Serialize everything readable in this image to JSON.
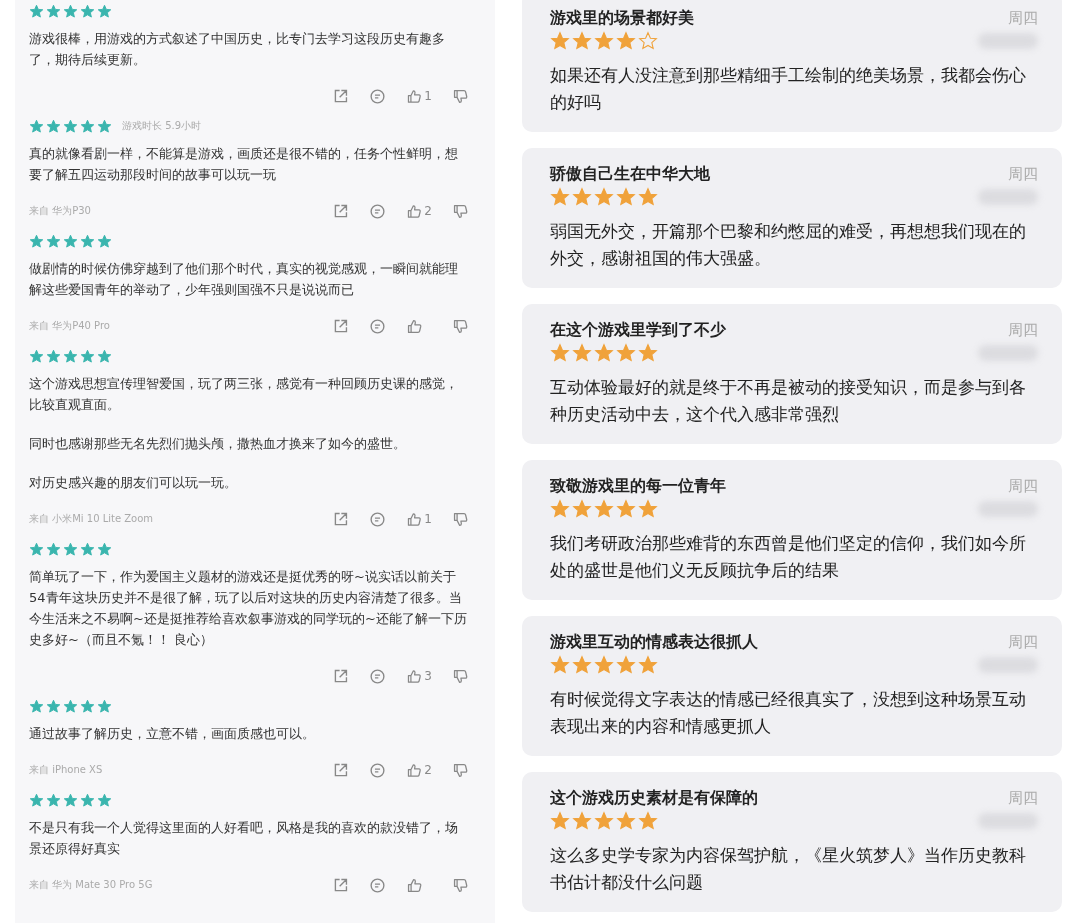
{
  "app_reviews": [
    {
      "stars": 5,
      "paragraphs": [
        "游戏很棒，用游戏的方式叙述了中国历史，比专门去学习这段历史有趣多了，期待后续更新。"
      ],
      "likes": "1"
    },
    {
      "stars": 5,
      "playtime": "游戏时长 5.9小时",
      "paragraphs": [
        "真的就像看剧一样，不能算是游戏，画质还是很不错的，任务个性鲜明，想要了解五四运动那段时间的故事可以玩一玩"
      ],
      "device": "来自 华为P30",
      "likes": "2"
    },
    {
      "stars": 5,
      "paragraphs": [
        "做剧情的时候仿佛穿越到了他们那个时代，真实的视觉感观，一瞬间就能理解这些爱国青年的举动了，少年强则国强不只是说说而已"
      ],
      "device": "来自 华为P40 Pro"
    },
    {
      "stars": 5,
      "paragraphs": [
        "这个游戏思想宣传理智爱国，玩了两三张，感觉有一种回顾历史课的感觉，比较直观直面。",
        "同时也感谢那些无名先烈们抛头颅，撒热血才换来了如今的盛世。",
        "对历史感兴趣的朋友们可以玩一玩。"
      ],
      "device": "来自 小米Mi 10 Lite Zoom",
      "likes": "1"
    },
    {
      "stars": 5,
      "paragraphs": [
        "简单玩了一下，作为爱国主义题材的游戏还是挺优秀的呀~说实话以前关于54青年这块历史并不是很了解，玩了以后对这块的历史内容清楚了很多。当今生活来之不易啊~还是挺推荐给喜欢叙事游戏的同学玩的~还能了解一下历史多好~（而且不氪！！ 良心）"
      ],
      "likes": "3"
    },
    {
      "stars": 5,
      "paragraphs": [
        "通过故事了解历史，立意不错，画面质感也可以。"
      ],
      "device": "来自 iPhone XS",
      "likes": "2"
    },
    {
      "stars": 5,
      "paragraphs": [
        "不是只有我一个人觉得这里面的人好看吧，风格是我的喜欢的款没错了，场景还原得好真实"
      ],
      "device": "来自 华为 Mate 30 Pro 5G"
    }
  ],
  "store_reviews": [
    {
      "title": "游戏里的场景都好美",
      "date": "周四",
      "stars": 4,
      "body": "如果还有人没注意到那些精细手工绘制的绝美场景，我都会伤心的好吗"
    },
    {
      "title": "骄傲自己生在中华大地",
      "date": "周四",
      "stars": 5,
      "body": "弱国无外交，开篇那个巴黎和约憋屈的难受，再想想我们现在的外交，感谢祖国的伟大强盛。"
    },
    {
      "title": "在这个游戏里学到了不少",
      "date": "周四",
      "stars": 5,
      "body": "互动体验最好的就是终于不再是被动的接受知识，而是参与到各种历史活动中去，这个代入感非常强烈"
    },
    {
      "title": "致敬游戏里的每一位青年",
      "date": "周四",
      "stars": 5,
      "body": "我们考研政治那些难背的东西曾是他们坚定的信仰，我们如今所处的盛世是他们义无反顾抗争后的结果"
    },
    {
      "title": "游戏里互动的情感表达很抓人",
      "date": "周四",
      "stars": 5,
      "body": "有时候觉得文字表达的情感已经很真实了，没想到这种场景互动表现出来的内容和情感更抓人"
    },
    {
      "title": "这个游戏历史素材是有保障的",
      "date": "周四",
      "stars": 5,
      "body": "这么多史学专家为内容保驾护航，《星火筑梦人》当作历史教科书估计都没什么问题"
    }
  ]
}
